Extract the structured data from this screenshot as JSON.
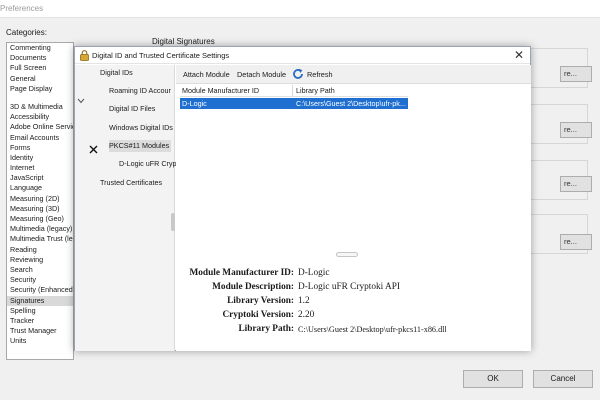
{
  "background": {
    "window_title": "Preferences",
    "categories_label": "Categories:",
    "section_title": "Digital Signatures",
    "categories": [
      "Commenting",
      "Documents",
      "Full Screen",
      "General",
      "Page Display",
      "3D & Multimedia",
      "Accessibility",
      "Adobe Online Services",
      "Email Accounts",
      "Forms",
      "Identity",
      "Internet",
      "JavaScript",
      "Language",
      "Measuring (2D)",
      "Measuring (3D)",
      "Measuring (Geo)",
      "Multimedia (legacy)",
      "Multimedia Trust (legacy)",
      "Reading",
      "Reviewing",
      "Search",
      "Security",
      "Security (Enhanced)",
      "Signatures",
      "Spelling",
      "Tracker",
      "Trust Manager",
      "Units"
    ],
    "more_label": "re...",
    "ok_label": "OK",
    "cancel_label": "Cancel"
  },
  "dialog": {
    "title": "Digital ID and Trusted Certificate Settings",
    "close_glyph": "✕",
    "tree": {
      "digital_ids": "Digital IDs",
      "roaming": "Roaming ID Accour",
      "files": "Digital ID Files",
      "windows": "Windows Digital IDs",
      "pkcs": "PKCS#11 Modules a",
      "dlogic": "D-Logic uFR Cryp",
      "trusted": "Trusted Certificates"
    },
    "toolbar": {
      "attach": "Attach Module",
      "detach": "Detach Module",
      "refresh": "Refresh"
    },
    "grid": {
      "headers": [
        "Module Manufacturer ID",
        "Library Path"
      ],
      "rows": [
        {
          "manufacturer": "D-Logic",
          "path": "C:\\Users\\Guest 2\\Desktop\\ufr-pk..."
        }
      ]
    },
    "details": {
      "manufacturer_label": "Module Manufacturer ID:",
      "manufacturer_value": "D-Logic",
      "description_label": "Module Description:",
      "description_value": "D-Logic uFR Cryptoki API",
      "library_version_label": "Library Version:",
      "library_version_value": "1.2",
      "cryptoki_version_label": "Cryptoki Version:",
      "cryptoki_version_value": "2.20",
      "library_path_label": "Library Path:",
      "library_path_value": "C:\\Users\\Guest 2\\Desktop\\ufr-pkcs11-x86.dll"
    }
  },
  "colors": {
    "selection": "#1e6fd0",
    "refresh_icon": "#2b6cc4"
  }
}
